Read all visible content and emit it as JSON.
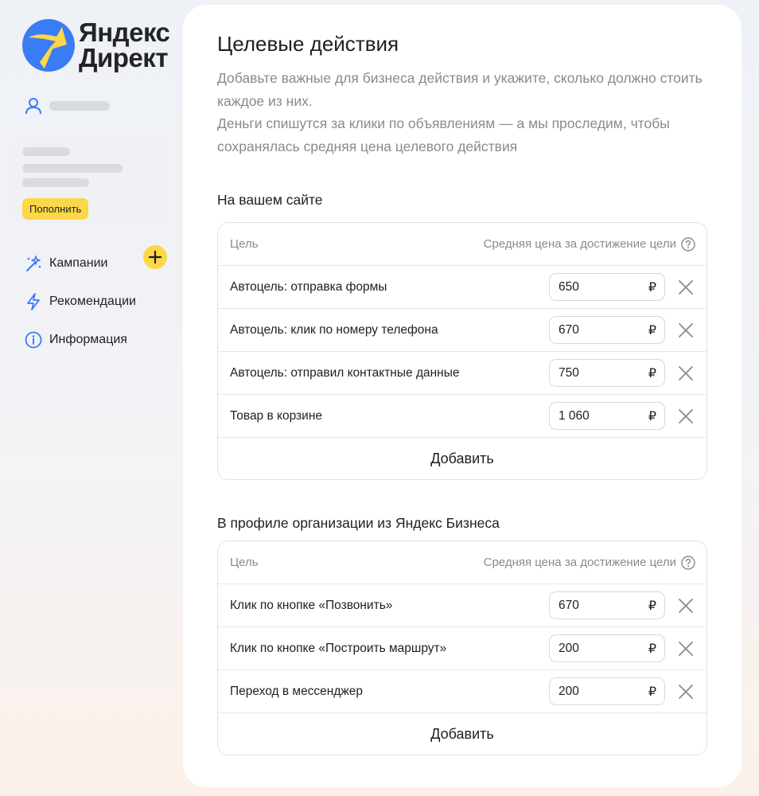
{
  "logo": {
    "line1": "Яндекс",
    "line2": "Директ"
  },
  "sidebar": {
    "topup_label": "Пополнить",
    "nav": [
      {
        "label": "Кампании",
        "icon": "wand-icon"
      },
      {
        "label": "Рекомендации",
        "icon": "lightning-icon"
      },
      {
        "label": "Информация",
        "icon": "info-icon"
      }
    ]
  },
  "page": {
    "title": "Целевые действия",
    "description_line1": "Добавьте важные для бизнеса действия и укажите, сколько должно стоить каждое из них.",
    "description_line2": "Деньги спишутся за клики по объявлениям — а мы проследим, чтобы сохранялась средняя цена целевого действия"
  },
  "sections": [
    {
      "title": "На вашем сайте",
      "col_goal": "Цель",
      "col_price": "Средняя цена за достижение цели",
      "rows": [
        {
          "name": "Автоцель: отправка формы",
          "price": "650"
        },
        {
          "name": "Автоцель: клик по номеру телефона",
          "price": "670"
        },
        {
          "name": "Автоцель: отправил контактные данные",
          "price": "750"
        },
        {
          "name": "Товар в корзине",
          "price": "1 060"
        }
      ],
      "add_label": "Добавить"
    },
    {
      "title": "В профиле организации из Яндекс Бизнеса",
      "col_goal": "Цель",
      "col_price": "Средняя цена за достижение цели",
      "rows": [
        {
          "name": "Клик по кнопке «Позвонить»",
          "price": "670"
        },
        {
          "name": "Клик по кнопке «Построить маршрут»",
          "price": "200"
        },
        {
          "name": "Переход в мессенджер",
          "price": "200"
        }
      ],
      "add_label": "Добавить"
    }
  ],
  "currency_symbol": "₽",
  "colors": {
    "accent_yellow": "#fcd748",
    "logo_blue": "#3a7cf5",
    "muted_text": "#8a8a8f"
  }
}
